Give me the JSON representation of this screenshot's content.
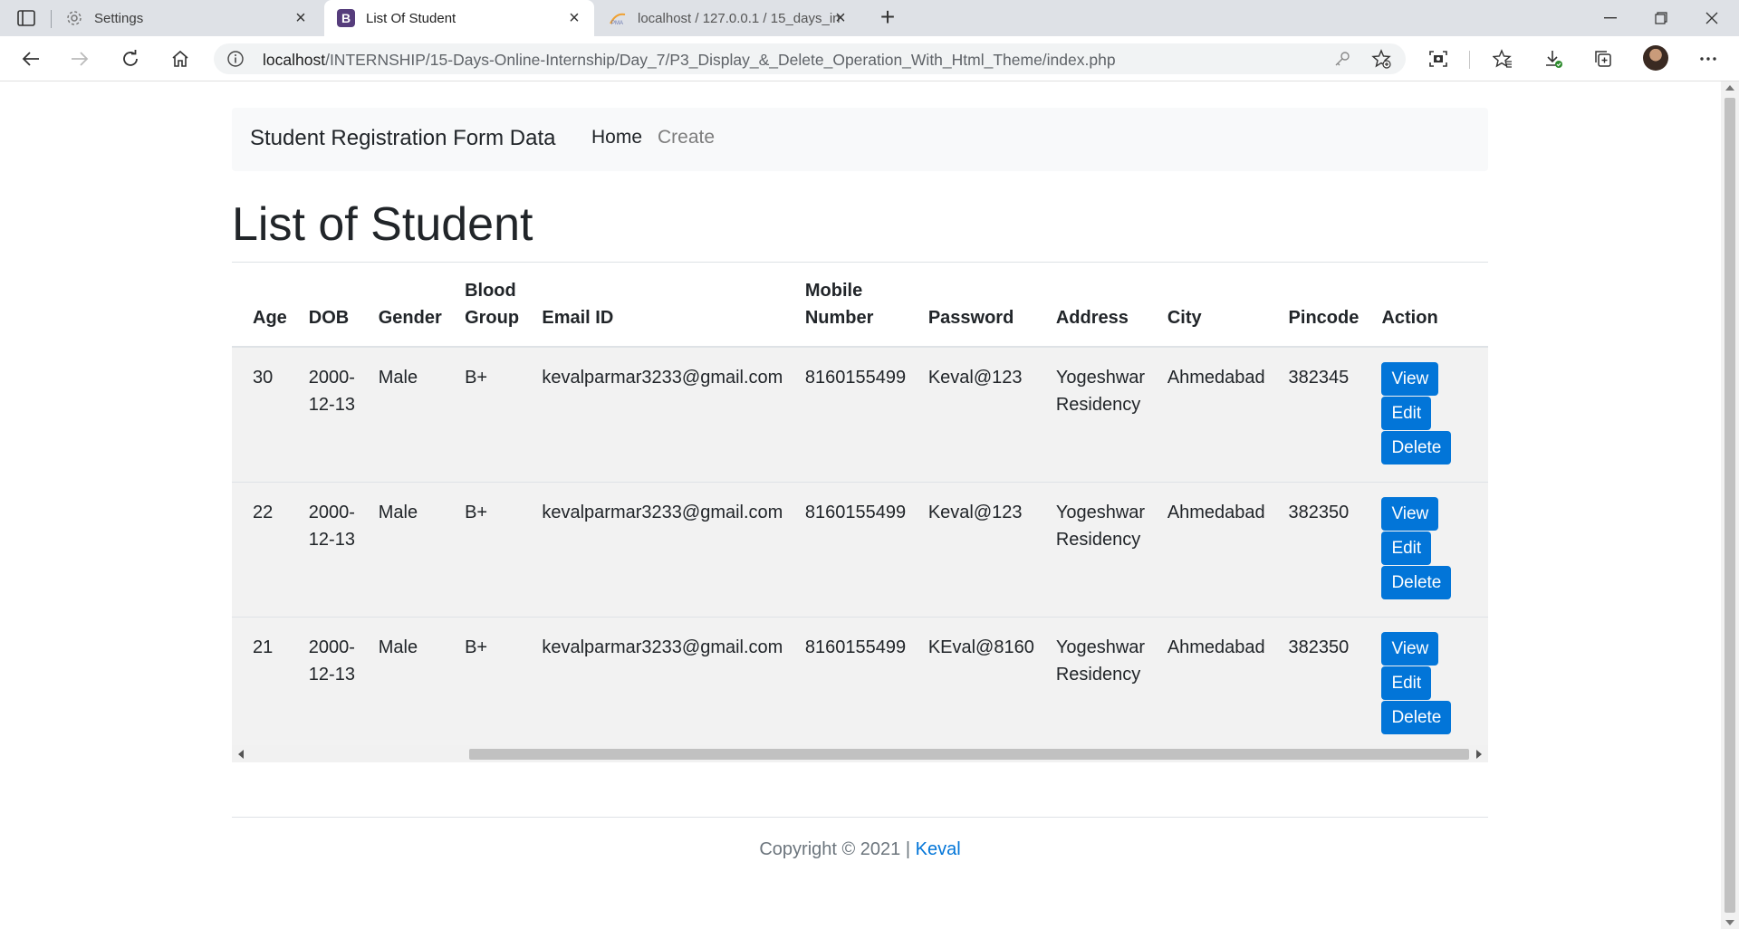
{
  "browser": {
    "tabs": [
      {
        "title": "Settings",
        "icon": "gear-icon",
        "active": false
      },
      {
        "title": "List Of Student",
        "icon": "bootstrap-logo-icon",
        "active": true
      },
      {
        "title": "localhost / 127.0.0.1 / 15_days_in",
        "icon": "phpmyadmin-icon",
        "active": false
      }
    ],
    "url_host": "localhost",
    "url_path": "/INTERNSHIP/15-Days-Online-Internship/Day_7/P3_Display_&_Delete_Operation_With_Html_Theme/index.php"
  },
  "navbar": {
    "brand": "Student Registration Form Data",
    "links": [
      "Home",
      "Create"
    ]
  },
  "page": {
    "title": "List of Student"
  },
  "table": {
    "headers": [
      "Age",
      "DOB",
      "Gender",
      "Blood Group",
      "Email ID",
      "Mobile Number",
      "Password",
      "Address",
      "City",
      "Pincode",
      "Action"
    ],
    "rows": [
      {
        "age": "30",
        "dob": "2000-12-13",
        "gender": "Male",
        "blood": "B+",
        "email": "kevalparmar3233@gmail.com",
        "mobile": "8160155499",
        "password": "Keval@123",
        "address": "Yogeshwar Residency",
        "city": "Ahmedabad",
        "pincode": "382345"
      },
      {
        "age": "22",
        "dob": "2000-12-13",
        "gender": "Male",
        "blood": "B+",
        "email": "kevalparmar3233@gmail.com",
        "mobile": "8160155499",
        "password": "Keval@123",
        "address": "Yogeshwar Residency",
        "city": "Ahmedabad",
        "pincode": "382350"
      },
      {
        "age": "21",
        "dob": "2000-12-13",
        "gender": "Male",
        "blood": "B+",
        "email": "kevalparmar3233@gmail.com",
        "mobile": "8160155499",
        "password": "KEval@8160",
        "address": "Yogeshwar Residency",
        "city": "Ahmedabad",
        "pincode": "382350"
      }
    ],
    "actions": {
      "view": "View",
      "edit": "Edit",
      "delete": "Delete"
    }
  },
  "footer": {
    "text": "Copyright © 2021 |",
    "link": "Keval"
  },
  "colors": {
    "primary": "#0275d8",
    "navbar_bg": "#f8f9fa",
    "row_bg": "#f2f2f2"
  }
}
